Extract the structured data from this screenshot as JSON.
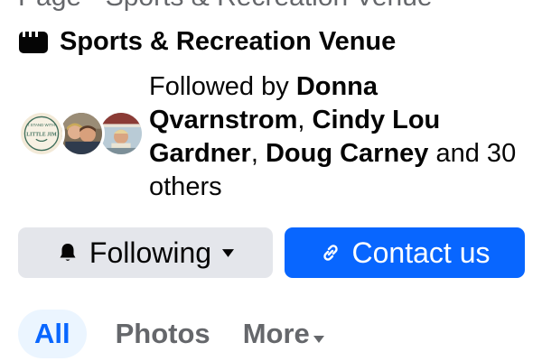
{
  "header": {
    "cut_title": "Page · Sports & Recreation Venue"
  },
  "category": {
    "icon": "page-flag-icon",
    "label": "Sports & Recreation Venue"
  },
  "followers": {
    "prefix": "Followed by ",
    "names": [
      "Donna Qvarnstrom",
      "Cindy Lou Gardner",
      "Doug Carney"
    ],
    "separator": ", ",
    "suffix": " and 30 others",
    "avatars": [
      {
        "name": "little-jim-logo-avatar",
        "logo_text_top": "I STAND WITH",
        "logo_text_main": "LITTLE JIM"
      },
      {
        "name": "couple-photo-avatar"
      },
      {
        "name": "boat-photo-avatar"
      }
    ]
  },
  "actions": {
    "following_label": "Following",
    "following_icon": "bell-icon",
    "contact_label": "Contact us",
    "contact_icon": "link-icon"
  },
  "tabs": [
    {
      "label": "All",
      "active": true
    },
    {
      "label": "Photos",
      "active": false
    },
    {
      "label": "More",
      "active": false,
      "has_dropdown": true
    }
  ],
  "colors": {
    "accent": "#0866ff",
    "secondary_button": "#e4e6eb",
    "active_tab_bg": "#ebf5ff",
    "muted_text": "#65676b"
  }
}
